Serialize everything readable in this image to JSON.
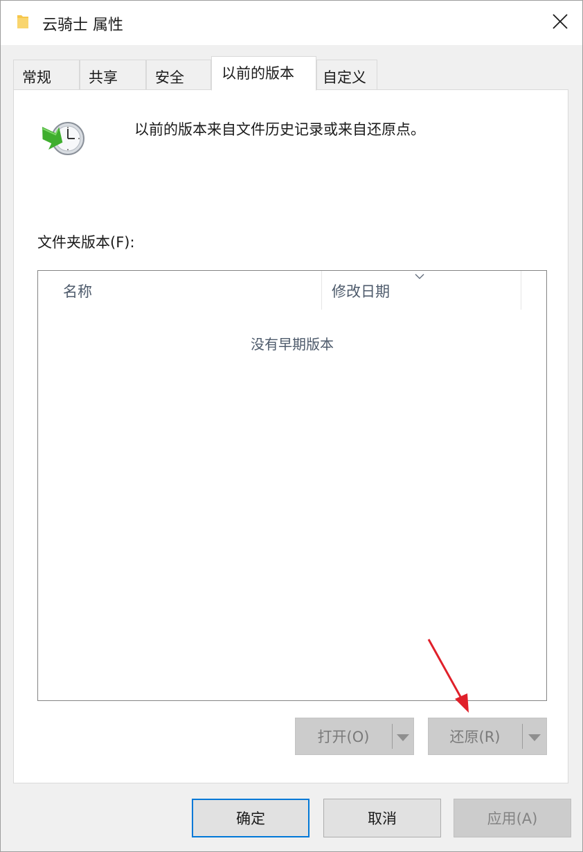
{
  "window": {
    "title": "云骑士 属性",
    "folder_icon": "folder-icon",
    "close_icon": "close-icon"
  },
  "tabs": [
    {
      "label": "常规",
      "active": false
    },
    {
      "label": "共享",
      "active": false
    },
    {
      "label": "安全",
      "active": false
    },
    {
      "label": "以前的版本",
      "active": true
    },
    {
      "label": "自定义",
      "active": false
    }
  ],
  "panel": {
    "icon": "restore-clock-icon",
    "description": "以前的版本来自文件历史记录或来自还原点。",
    "list_label": "文件夹版本(F):",
    "columns": [
      "名称",
      "修改日期"
    ],
    "empty_message": "没有早期版本",
    "open_button": "打开(O)",
    "restore_button": "还原(R)"
  },
  "footer": {
    "ok": "确定",
    "cancel": "取消",
    "apply": "应用(A)"
  },
  "colors": {
    "accent": "#0078d7",
    "annotation_arrow": "#e0202a",
    "folder": "#f6c64a"
  }
}
